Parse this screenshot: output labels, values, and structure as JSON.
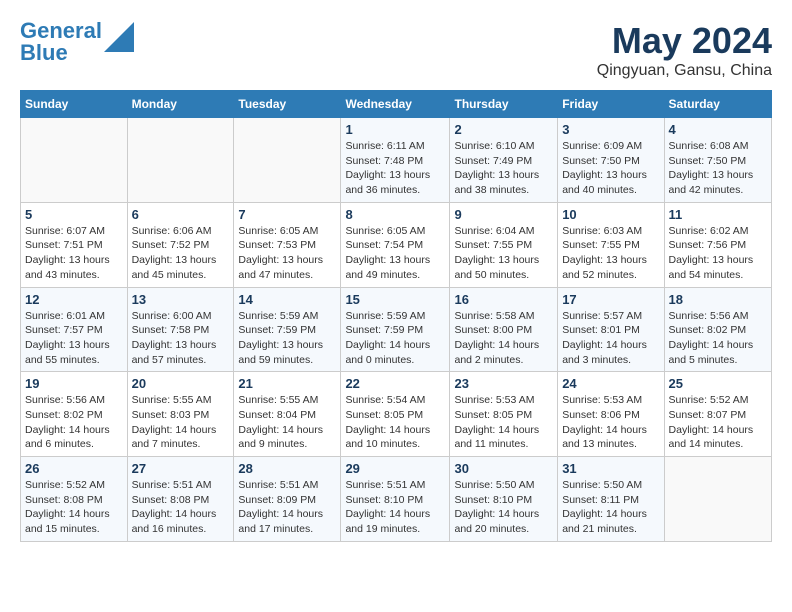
{
  "header": {
    "logo_line1": "General",
    "logo_line2": "Blue",
    "month_year": "May 2024",
    "location": "Qingyuan, Gansu, China"
  },
  "weekdays": [
    "Sunday",
    "Monday",
    "Tuesday",
    "Wednesday",
    "Thursday",
    "Friday",
    "Saturday"
  ],
  "weeks": [
    [
      {
        "day": "",
        "info": ""
      },
      {
        "day": "",
        "info": ""
      },
      {
        "day": "",
        "info": ""
      },
      {
        "day": "1",
        "info": "Sunrise: 6:11 AM\nSunset: 7:48 PM\nDaylight: 13 hours\nand 36 minutes."
      },
      {
        "day": "2",
        "info": "Sunrise: 6:10 AM\nSunset: 7:49 PM\nDaylight: 13 hours\nand 38 minutes."
      },
      {
        "day": "3",
        "info": "Sunrise: 6:09 AM\nSunset: 7:50 PM\nDaylight: 13 hours\nand 40 minutes."
      },
      {
        "day": "4",
        "info": "Sunrise: 6:08 AM\nSunset: 7:50 PM\nDaylight: 13 hours\nand 42 minutes."
      }
    ],
    [
      {
        "day": "5",
        "info": "Sunrise: 6:07 AM\nSunset: 7:51 PM\nDaylight: 13 hours\nand 43 minutes."
      },
      {
        "day": "6",
        "info": "Sunrise: 6:06 AM\nSunset: 7:52 PM\nDaylight: 13 hours\nand 45 minutes."
      },
      {
        "day": "7",
        "info": "Sunrise: 6:05 AM\nSunset: 7:53 PM\nDaylight: 13 hours\nand 47 minutes."
      },
      {
        "day": "8",
        "info": "Sunrise: 6:05 AM\nSunset: 7:54 PM\nDaylight: 13 hours\nand 49 minutes."
      },
      {
        "day": "9",
        "info": "Sunrise: 6:04 AM\nSunset: 7:55 PM\nDaylight: 13 hours\nand 50 minutes."
      },
      {
        "day": "10",
        "info": "Sunrise: 6:03 AM\nSunset: 7:55 PM\nDaylight: 13 hours\nand 52 minutes."
      },
      {
        "day": "11",
        "info": "Sunrise: 6:02 AM\nSunset: 7:56 PM\nDaylight: 13 hours\nand 54 minutes."
      }
    ],
    [
      {
        "day": "12",
        "info": "Sunrise: 6:01 AM\nSunset: 7:57 PM\nDaylight: 13 hours\nand 55 minutes."
      },
      {
        "day": "13",
        "info": "Sunrise: 6:00 AM\nSunset: 7:58 PM\nDaylight: 13 hours\nand 57 minutes."
      },
      {
        "day": "14",
        "info": "Sunrise: 5:59 AM\nSunset: 7:59 PM\nDaylight: 13 hours\nand 59 minutes."
      },
      {
        "day": "15",
        "info": "Sunrise: 5:59 AM\nSunset: 7:59 PM\nDaylight: 14 hours\nand 0 minutes."
      },
      {
        "day": "16",
        "info": "Sunrise: 5:58 AM\nSunset: 8:00 PM\nDaylight: 14 hours\nand 2 minutes."
      },
      {
        "day": "17",
        "info": "Sunrise: 5:57 AM\nSunset: 8:01 PM\nDaylight: 14 hours\nand 3 minutes."
      },
      {
        "day": "18",
        "info": "Sunrise: 5:56 AM\nSunset: 8:02 PM\nDaylight: 14 hours\nand 5 minutes."
      }
    ],
    [
      {
        "day": "19",
        "info": "Sunrise: 5:56 AM\nSunset: 8:02 PM\nDaylight: 14 hours\nand 6 minutes."
      },
      {
        "day": "20",
        "info": "Sunrise: 5:55 AM\nSunset: 8:03 PM\nDaylight: 14 hours\nand 7 minutes."
      },
      {
        "day": "21",
        "info": "Sunrise: 5:55 AM\nSunset: 8:04 PM\nDaylight: 14 hours\nand 9 minutes."
      },
      {
        "day": "22",
        "info": "Sunrise: 5:54 AM\nSunset: 8:05 PM\nDaylight: 14 hours\nand 10 minutes."
      },
      {
        "day": "23",
        "info": "Sunrise: 5:53 AM\nSunset: 8:05 PM\nDaylight: 14 hours\nand 11 minutes."
      },
      {
        "day": "24",
        "info": "Sunrise: 5:53 AM\nSunset: 8:06 PM\nDaylight: 14 hours\nand 13 minutes."
      },
      {
        "day": "25",
        "info": "Sunrise: 5:52 AM\nSunset: 8:07 PM\nDaylight: 14 hours\nand 14 minutes."
      }
    ],
    [
      {
        "day": "26",
        "info": "Sunrise: 5:52 AM\nSunset: 8:08 PM\nDaylight: 14 hours\nand 15 minutes."
      },
      {
        "day": "27",
        "info": "Sunrise: 5:51 AM\nSunset: 8:08 PM\nDaylight: 14 hours\nand 16 minutes."
      },
      {
        "day": "28",
        "info": "Sunrise: 5:51 AM\nSunset: 8:09 PM\nDaylight: 14 hours\nand 17 minutes."
      },
      {
        "day": "29",
        "info": "Sunrise: 5:51 AM\nSunset: 8:10 PM\nDaylight: 14 hours\nand 19 minutes."
      },
      {
        "day": "30",
        "info": "Sunrise: 5:50 AM\nSunset: 8:10 PM\nDaylight: 14 hours\nand 20 minutes."
      },
      {
        "day": "31",
        "info": "Sunrise: 5:50 AM\nSunset: 8:11 PM\nDaylight: 14 hours\nand 21 minutes."
      },
      {
        "day": "",
        "info": ""
      }
    ]
  ]
}
